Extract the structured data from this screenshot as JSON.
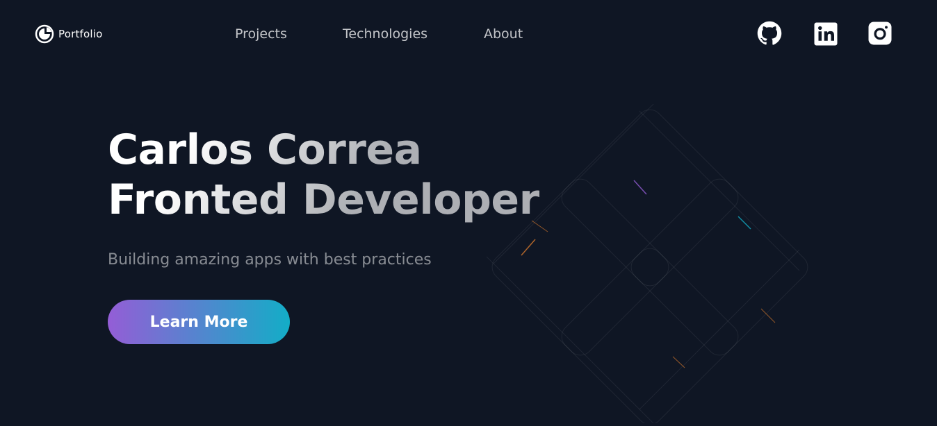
{
  "header": {
    "logo_text": "Portfolio",
    "nav": [
      {
        "label": "Projects"
      },
      {
        "label": "Technologies"
      },
      {
        "label": "About"
      }
    ],
    "social": [
      {
        "icon": "github-icon"
      },
      {
        "icon": "linkedin-icon"
      },
      {
        "icon": "instagram-icon"
      }
    ]
  },
  "hero": {
    "title_line1": "Carlos Correa",
    "title_line2": "Fronted Developer",
    "subtitle": "Building amazing apps with best practices",
    "cta_label": "Learn More"
  },
  "colors": {
    "background": "#0f1624",
    "text": "#ffffff",
    "cta_gradient_start": "#945DD6",
    "cta_gradient_mid": "#6978D1",
    "cta_gradient_end": "#13ADC7"
  }
}
